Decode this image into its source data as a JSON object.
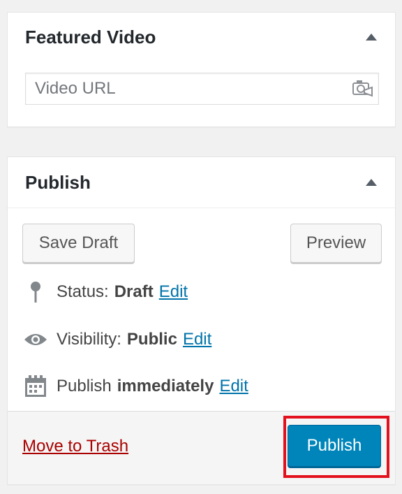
{
  "featured_video": {
    "title": "Featured Video",
    "url_placeholder": "Video URL",
    "url_value": ""
  },
  "publish": {
    "title": "Publish",
    "save_draft_label": "Save Draft",
    "preview_label": "Preview",
    "status": {
      "label": "Status:",
      "value": "Draft",
      "edit": "Edit"
    },
    "visibility": {
      "label": "Visibility:",
      "value": "Public",
      "edit": "Edit"
    },
    "schedule": {
      "label": "Publish",
      "value": "immediately",
      "edit": "Edit"
    },
    "trash_label": "Move to Trash",
    "publish_label": "Publish"
  },
  "colors": {
    "primary_button": "#0085ba",
    "link": "#0073aa",
    "trash_link": "#aa0000",
    "highlight": "#e3111e"
  }
}
